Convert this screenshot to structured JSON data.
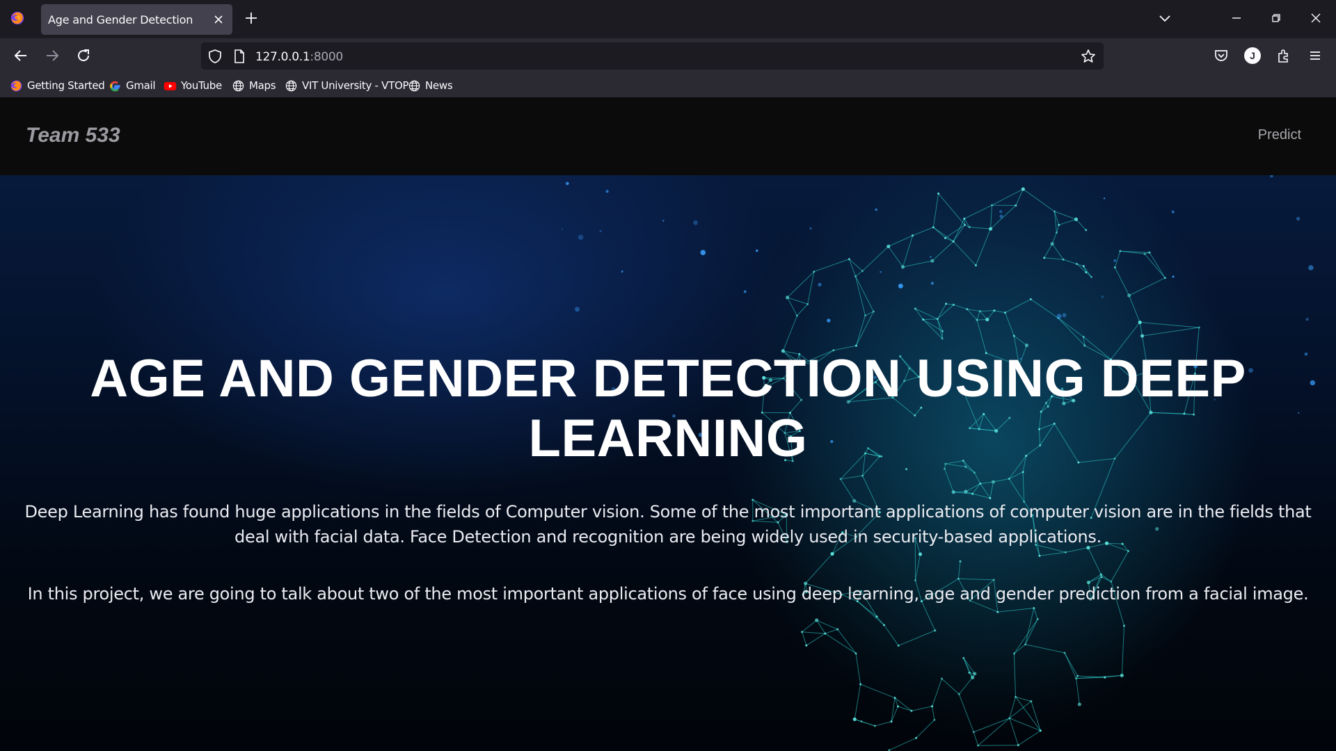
{
  "browser": {
    "tab_title": "Age and Gender Detection",
    "url_host": "127.0.0.1",
    "url_port": ":8000",
    "profile_initial": "J",
    "bookmarks": [
      {
        "label": "Getting Started",
        "icon": "firefox-icon"
      },
      {
        "label": "Gmail",
        "icon": "google-icon"
      },
      {
        "label": "YouTube",
        "icon": "youtube-icon"
      },
      {
        "label": "Maps",
        "icon": "globe-icon"
      },
      {
        "label": "VIT University - VTOP",
        "icon": "globe-icon"
      },
      {
        "label": "News",
        "icon": "globe-icon"
      }
    ]
  },
  "site": {
    "brand": "Team 533",
    "nav_link": "Predict",
    "hero_title": "AGE AND GENDER DETECTION USING DEEP LEARNING",
    "paragraph_1": "Deep Learning has found huge applications in the fields of Computer vision. Some of the most important applications of computer vision are in the fields that deal with facial data. Face Detection and recognition are being widely used in security-based applications.",
    "paragraph_2": "In this project, we are going to talk about two of the most important applications of face using deep learning, age and gender prediction from a facial image."
  },
  "colors": {
    "accent_mesh": "#2fd3d1",
    "page_bg": "#06060a",
    "navbar_bg": "#0b0b0b"
  }
}
